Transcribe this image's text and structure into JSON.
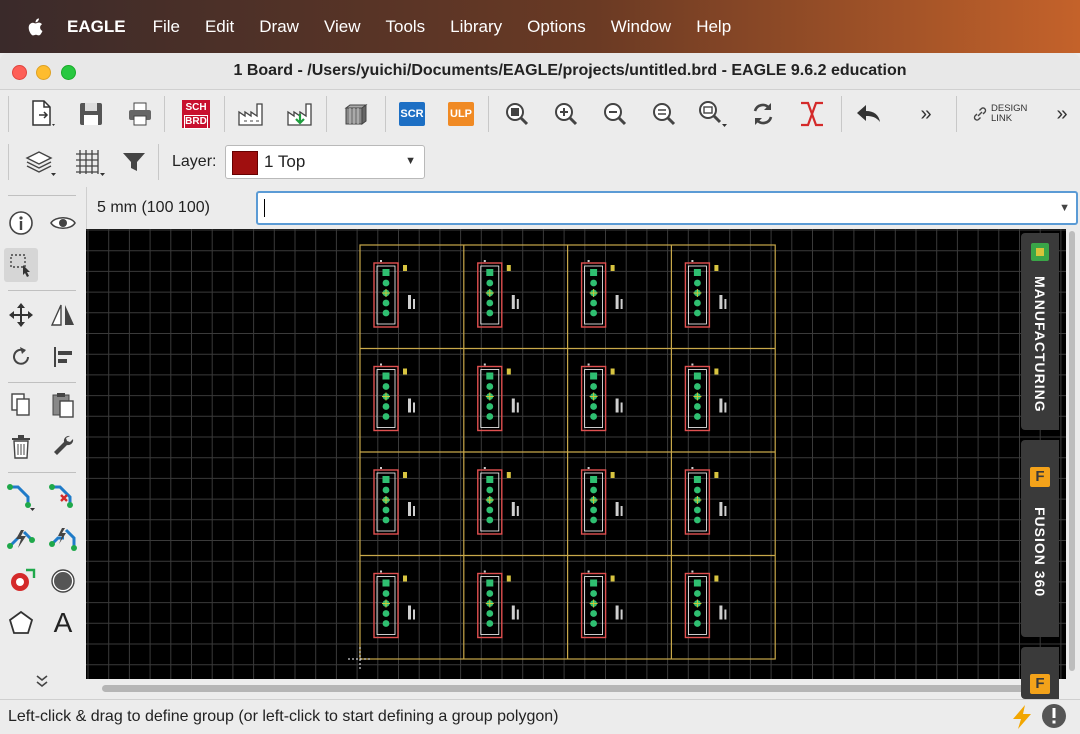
{
  "menu": {
    "app_name": "EAGLE",
    "items": [
      "File",
      "Edit",
      "Draw",
      "View",
      "Tools",
      "Library",
      "Options",
      "Window",
      "Help"
    ]
  },
  "window": {
    "title": "1 Board - /Users/yuichi/Documents/EAGLE/projects/untitled.brd - EAGLE 9.6.2 education"
  },
  "toolbar": {
    "sch_brd_top": "SCH",
    "sch_brd_bottom": "BRD",
    "scr_label": "SCR",
    "ulp_label": "ULP",
    "more_label": "»",
    "design_link_line1": "DESIGN",
    "design_link_line2": "LINK",
    "more_right_label": "»"
  },
  "layer_bar": {
    "label": "Layer:",
    "selected_layer": "1 Top",
    "selected_color": "#a00f0f"
  },
  "coord_bar": {
    "grid_readout": "5 mm (100 100)",
    "command_value": ""
  },
  "side_panels": {
    "manufacturing": "MANUFACTURING",
    "fusion": "FUSION 360",
    "fusion_icon": "F"
  },
  "left_tools": {
    "text_tool": "A",
    "expand_icon": "chevron-down-icon"
  },
  "board": {
    "panel_rows": 4,
    "panel_cols": 4
  },
  "status": {
    "message": "Left-click & drag to define group (or left-click to start defining a group polygon)"
  },
  "colors": {
    "accent": "#5b9bd5",
    "grid": "#3a3a3a",
    "outline": "#c8a84a",
    "part_outline": "#e05050",
    "pads": "#2fbf71"
  }
}
